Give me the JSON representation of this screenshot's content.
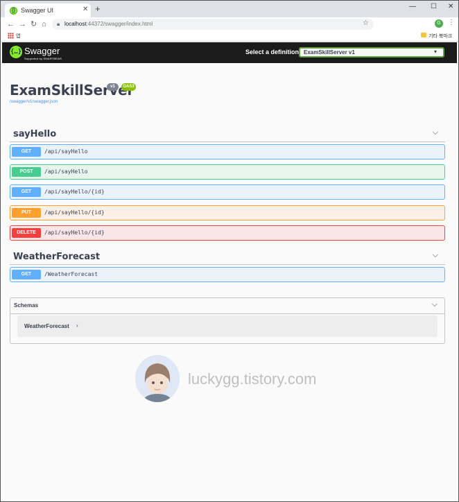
{
  "browser": {
    "tab_title": "Swagger UI",
    "tab_close": "✕",
    "new_tab": "+",
    "window_controls": [
      "—",
      "☐",
      "✕"
    ],
    "url_host": "localhost",
    "url_rest": ":44372/swagger/index.html",
    "profile_initial": "G",
    "apps_label": "앱",
    "other_bookmarks": "기타 북마크"
  },
  "topbar": {
    "brand": "Swagger",
    "brand_sub": "Supported by SMARTBEAR",
    "select_label": "Select a definition",
    "selected_definition": "ExamSkillServer v1"
  },
  "info": {
    "title": "ExamSkillServer",
    "version": "v1",
    "oas": "OAS3",
    "spec_url": "/swagger/v1/swagger.json"
  },
  "tags": [
    {
      "name": "sayHello",
      "operations": [
        {
          "method": "GET",
          "path": "/api/sayHello"
        },
        {
          "method": "POST",
          "path": "/api/sayHello"
        },
        {
          "method": "GET",
          "path": "/api/sayHello/{id}"
        },
        {
          "method": "PUT",
          "path": "/api/sayHello/{id}"
        },
        {
          "method": "DELETE",
          "path": "/api/sayHello/{id}"
        }
      ]
    },
    {
      "name": "WeatherForecast",
      "operations": [
        {
          "method": "GET",
          "path": "/WeatherForecast"
        }
      ]
    }
  ],
  "schemas": {
    "title": "Schemas",
    "models": [
      "WeatherForecast"
    ]
  },
  "watermark": {
    "text": "luckygg.tistory.com"
  },
  "colors": {
    "get": "#61affe",
    "post": "#49cc90",
    "put": "#fca130",
    "delete": "#f93e3e",
    "topbar": "#1b1b1b",
    "swagger_green": "#85ea2d"
  }
}
